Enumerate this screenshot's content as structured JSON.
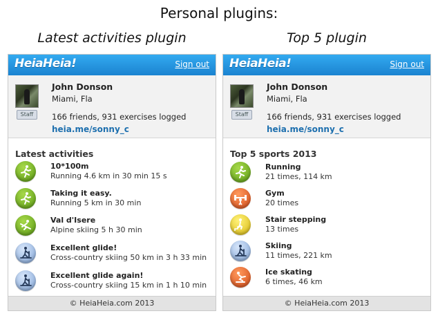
{
  "heading": "Personal plugins:",
  "subtitles": {
    "left": "Latest activities plugin",
    "right": "Top 5 plugin"
  },
  "header": {
    "logo": "HeiaHeia!",
    "sign_out": "Sign out"
  },
  "profile": {
    "name": "John Donson",
    "location": "Miami, Fla",
    "badge": "Staff",
    "stats": "166 friends, 931 exercises logged",
    "link": "heia.me/sonny_c"
  },
  "left_panel": {
    "section_title": "Latest activities",
    "items": [
      {
        "title": "10*100m",
        "subtitle": "Running 4.6 km in 30 min 15 s",
        "icon": "running-icon",
        "color": "green"
      },
      {
        "title": "Taking it easy.",
        "subtitle": "Running 5 km in 30 min",
        "icon": "running-icon",
        "color": "green"
      },
      {
        "title": "Val d'Isere",
        "subtitle": "Alpine skiing 5 h 30 min",
        "icon": "alpine-skiing-icon",
        "color": "green"
      },
      {
        "title": "Excellent glide!",
        "subtitle": "Cross-country skiing 50 km in 3 h 33 min",
        "icon": "cross-country-skiing-icon",
        "color": "blue"
      },
      {
        "title": "Excellent glide again!",
        "subtitle": "Cross-country skiing 15 km in 1 h 10 min",
        "icon": "cross-country-skiing-icon",
        "color": "blue"
      }
    ]
  },
  "right_panel": {
    "section_title": "Top 5 sports 2013",
    "items": [
      {
        "title": "Running",
        "subtitle": "21 times, 114 km",
        "icon": "running-icon",
        "color": "green"
      },
      {
        "title": "Gym",
        "subtitle": "20 times",
        "icon": "weightlifting-icon",
        "color": "orange"
      },
      {
        "title": "Stair stepping",
        "subtitle": "13 times",
        "icon": "stair-stepping-icon",
        "color": "yellow"
      },
      {
        "title": "Skiing",
        "subtitle": "11 times, 221 km",
        "icon": "skiing-icon",
        "color": "blue"
      },
      {
        "title": "Ice skating",
        "subtitle": "6 times, 46 km",
        "icon": "ice-skating-icon",
        "color": "orange"
      }
    ]
  },
  "footer": "© HeiaHeia.com 2013"
}
